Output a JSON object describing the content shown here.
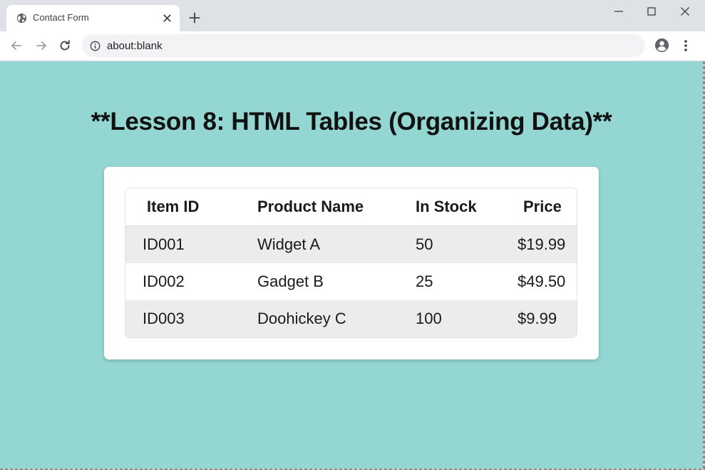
{
  "browser": {
    "tab": {
      "title": "Contact Form",
      "favicon": "globe-icon",
      "close_icon": "close-icon"
    },
    "new_tab_icon": "plus-icon",
    "window_controls": [
      "minimize-icon",
      "maximize-icon",
      "close-icon"
    ],
    "toolbar": {
      "back_icon": "arrow-left-icon",
      "forward_icon": "arrow-right-icon",
      "reload_icon": "reload-icon",
      "info_icon": "info-icon",
      "url": "about:blank",
      "profile_icon": "account-circle-icon",
      "menu_icon": "kebab-menu-icon"
    }
  },
  "page": {
    "background_color": "#94d6d1",
    "heading": "**Lesson 8: HTML Tables (Organizing Data)**",
    "table": {
      "headers": [
        "Item ID",
        "Product Name",
        "In Stock",
        "Price"
      ],
      "rows": [
        [
          "ID001",
          "Widget A",
          "50",
          "$19.99"
        ],
        [
          "ID002",
          "Gadget B",
          "25",
          "$49.50"
        ],
        [
          "ID003",
          "Doohickey C",
          "100",
          "$9.99"
        ]
      ],
      "stripe_color": "#ececec"
    }
  }
}
